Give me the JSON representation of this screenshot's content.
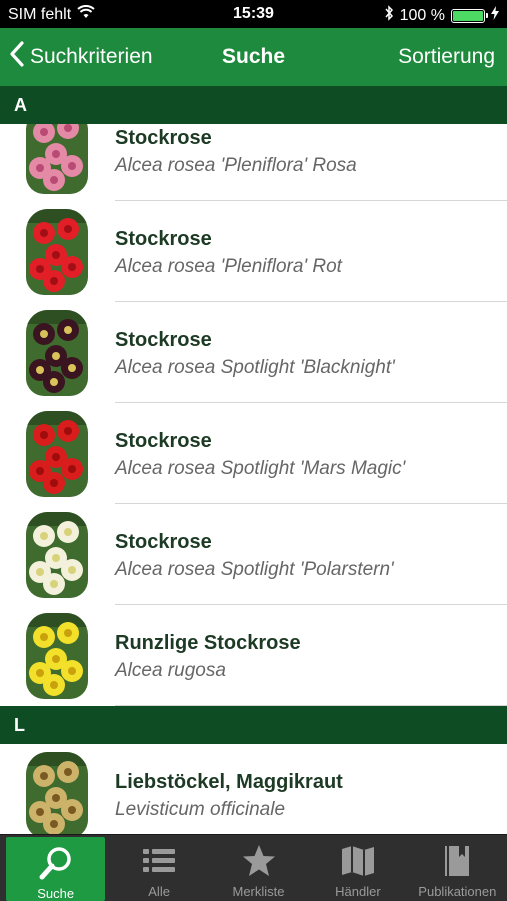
{
  "status_bar": {
    "carrier": "SIM fehlt",
    "time": "15:39",
    "battery_percent": "100 %",
    "battery_level": 1.0
  },
  "navbar": {
    "back_label": "Suchkriterien",
    "title": "Suche",
    "sort_label": "Sortierung"
  },
  "sections": [
    {
      "letter": "A",
      "items": [
        {
          "common": "Stockrose",
          "latin": "Alcea rosea 'Pleniflora' Rosa",
          "flower_color": "#e58aa6",
          "center_color": "#b94a73"
        },
        {
          "common": "Stockrose",
          "latin": "Alcea rosea 'Pleniflora' Rot",
          "flower_color": "#e21f26",
          "center_color": "#a10f15"
        },
        {
          "common": "Stockrose",
          "latin": "Alcea rosea Spotlight 'Blacknight'",
          "flower_color": "#3a1420",
          "center_color": "#d9c25a"
        },
        {
          "common": "Stockrose",
          "latin": "Alcea rosea Spotlight 'Mars Magic'",
          "flower_color": "#d91c1c",
          "center_color": "#9e0c0c"
        },
        {
          "common": "Stockrose",
          "latin": "Alcea rosea Spotlight 'Polarstern'",
          "flower_color": "#f3f1dc",
          "center_color": "#d8d27a"
        },
        {
          "common": "Runzlige Stockrose",
          "latin": "Alcea rugosa",
          "flower_color": "#f2e02a",
          "center_color": "#c9a10d"
        }
      ]
    },
    {
      "letter": "L",
      "items": [
        {
          "common": "Liebstöckel, Maggikraut",
          "latin": "Levisticum officinale",
          "flower_color": "#cdb26a",
          "center_color": "#7a5a22"
        }
      ]
    }
  ],
  "tabs": [
    {
      "label": "Suche",
      "icon": "search-icon",
      "active": true
    },
    {
      "label": "Alle",
      "icon": "list-icon",
      "active": false
    },
    {
      "label": "Merkliste",
      "icon": "star-icon",
      "active": false
    },
    {
      "label": "Händler",
      "icon": "map-icon",
      "active": false
    },
    {
      "label": "Publikationen",
      "icon": "book-icon",
      "active": false
    }
  ],
  "colors": {
    "nav_green": "#1e8a3d",
    "section_green": "#0e4d24",
    "tab_active": "#1e9a43",
    "tabbar": "#2f2f2f"
  }
}
